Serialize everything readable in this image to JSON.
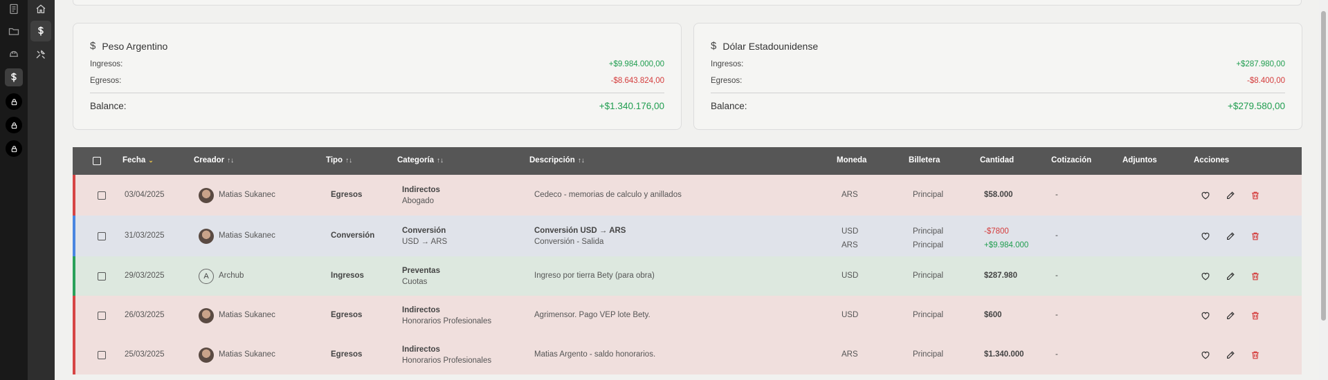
{
  "sidebar": {
    "rail_icons": [
      "receipt-icon",
      "folder-icon",
      "helmet-icon",
      "dollar-icon",
      "lock-icon",
      "lock-icon",
      "lock-icon"
    ],
    "subrail_icons": [
      "home-icon",
      "dollar-icon",
      "tools-icon"
    ]
  },
  "cards": [
    {
      "title": "Peso Argentino",
      "ingresos_label": "Ingresos:",
      "ingresos_value": "+$9.984.000,00",
      "egresos_label": "Egresos:",
      "egresos_value": "-$8.643.824,00",
      "balance_label": "Balance:",
      "balance_value": "+$1.340.176,00"
    },
    {
      "title": "Dólar Estadounidense",
      "ingresos_label": "Ingresos:",
      "ingresos_value": "+$287.980,00",
      "egresos_label": "Egresos:",
      "egresos_value": "-$8.400,00",
      "balance_label": "Balance:",
      "balance_value": "+$279.580,00"
    }
  ],
  "table": {
    "headers": {
      "fecha": "Fecha",
      "creador": "Creador",
      "tipo": "Tipo",
      "categoria": "Categoría",
      "descripcion": "Descripción",
      "moneda": "Moneda",
      "billetera": "Billetera",
      "cantidad": "Cantidad",
      "cotizacion": "Cotización",
      "adjuntos": "Adjuntos",
      "acciones": "Acciones"
    },
    "rows": [
      {
        "fecha": "03/04/2025",
        "creador": "Matias Sukanec",
        "avatar": "photo",
        "tipo": "Egresos",
        "cat1": "Indirectos",
        "cat2": "Abogado",
        "desc1": "Cedeco - memorias de calculo y anillados",
        "desc2": "",
        "moneda1": "ARS",
        "moneda2": "",
        "bill1": "Principal",
        "bill2": "",
        "cant1": "$58.000",
        "cant2": "",
        "cotizacion": "-",
        "color": "#f0dfdd",
        "accent": "#d64545"
      },
      {
        "fecha": "31/03/2025",
        "creador": "Matias Sukanec",
        "avatar": "photo",
        "tipo": "Conversión",
        "cat1": "Conversión",
        "cat2": "USD → ARS",
        "desc1": "Conversión USD → ARS",
        "desc2": "Conversión - Salida",
        "moneda1": "USD",
        "moneda2": "ARS",
        "bill1": "Principal",
        "bill2": "Principal",
        "cant1": "-$7800",
        "cant2": "+$9.984.000",
        "cotizacion": "-",
        "color": "#e0e3ea",
        "accent": "#4a86e0"
      },
      {
        "fecha": "29/03/2025",
        "creador": "Archub",
        "avatar": "A",
        "tipo": "Ingresos",
        "cat1": "Preventas",
        "cat2": "Cuotas",
        "desc1": "Ingreso por tierra Bety (para obra)",
        "desc2": "",
        "moneda1": "USD",
        "moneda2": "",
        "bill1": "Principal",
        "bill2": "",
        "cant1": "$287.980",
        "cant2": "",
        "cotizacion": "-",
        "color": "#dde8df",
        "accent": "#2aa15a"
      },
      {
        "fecha": "26/03/2025",
        "creador": "Matias Sukanec",
        "avatar": "photo",
        "tipo": "Egresos",
        "cat1": "Indirectos",
        "cat2": "Honorarios Profesionales",
        "desc1": "Agrimensor. Pago VEP lote Bety.",
        "desc2": "",
        "moneda1": "USD",
        "moneda2": "",
        "bill1": "Principal",
        "bill2": "",
        "cant1": "$600",
        "cant2": "",
        "cotizacion": "-",
        "color": "#f0dfdd",
        "accent": "#d64545"
      },
      {
        "fecha": "25/03/2025",
        "creador": "Matias Sukanec",
        "avatar": "photo",
        "tipo": "Egresos",
        "cat1": "Indirectos",
        "cat2": "Honorarios Profesionales",
        "desc1": "Matias Argento - saldo honorarios.",
        "desc2": "",
        "moneda1": "ARS",
        "moneda2": "",
        "bill1": "Principal",
        "bill2": "",
        "cant1": "$1.340.000",
        "cant2": "",
        "cotizacion": "-",
        "color": "#f0dfdd",
        "accent": "#d64545"
      }
    ]
  }
}
